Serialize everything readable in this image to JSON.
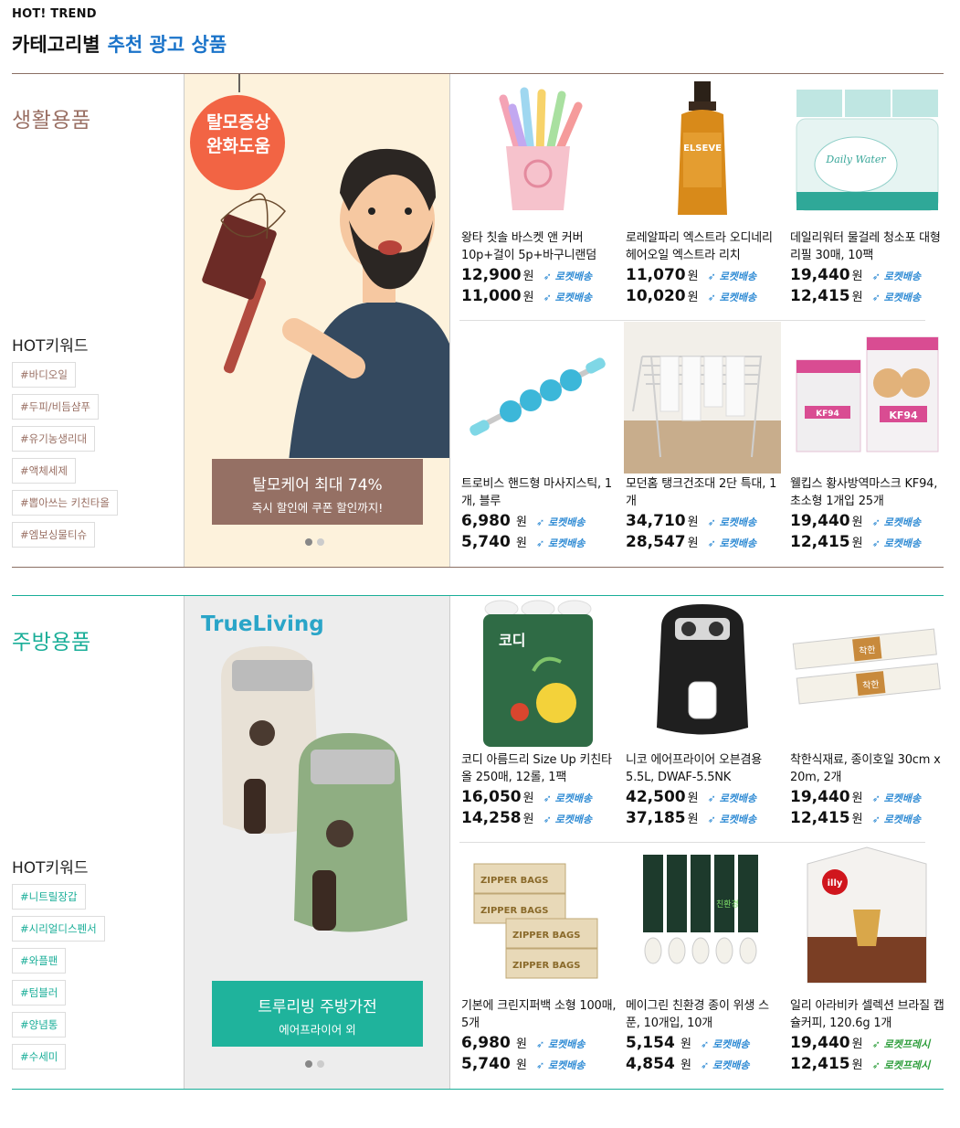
{
  "header": {
    "eyebrow": "HOT! TREND",
    "title": "카테고리별",
    "title_accent": "추천 광고 상품"
  },
  "sections": [
    {
      "category": "생활용품",
      "accent_color": "#9a7064",
      "line_color": "#8a6f63",
      "kw_title": "HOT키워드",
      "keywords": [
        "#바디오일",
        "#두피/비듬샴푸",
        "#유기농생리대",
        "#액체세제",
        "#뽑아쓰는 키친타올",
        "#엠보싱물티슈"
      ],
      "banner": {
        "badge": "탈모증상\n완화도움",
        "caption_main": "탈모케어 최대 74%",
        "caption_sub": "즉시 할인에 쿠폰 할인까지!",
        "caption_color": "#957064",
        "bg_color": "#fdf2dc"
      },
      "products": [
        {
          "name": "왕타 칫솔 바스켓 앤 커버 10p+걸이 5p+바구니랜덤",
          "price1": "12,900",
          "price2": "11,000",
          "won": "원",
          "tag1": "로켓배송",
          "tag2": "로켓배송",
          "icon": "toothbrush-cup"
        },
        {
          "name": "로레알파리 엑스트라 오디네리 헤어오일 엑스트라 리치",
          "price1": "11,070",
          "price2": "10,020",
          "won": "원",
          "tag1": "로켓배송",
          "tag2": "로켓배송",
          "icon": "hair-oil-bottle",
          "img_text": "ELSEVE"
        },
        {
          "name": "데일리워터 물걸레 청소포 대형리필 30매, 10팩",
          "price1": "19,440",
          "price2": "12,415",
          "won": "원",
          "tag1": "로켓배송",
          "tag2": "로켓배송",
          "icon": "wet-wipes-pack",
          "img_text": "Daily Water"
        },
        {
          "name": "트로비스 핸드형 마사지스틱, 1개, 블루",
          "price1": "6,980",
          "price2": "5,740",
          "won": "원",
          "tag1": "로켓배송",
          "tag2": "로켓배송",
          "icon": "massage-stick"
        },
        {
          "name": "모던홈 탱크건조대 2단 특대, 1개",
          "price1": "34,710",
          "price2": "28,547",
          "won": "원",
          "tag1": "로켓배송",
          "tag2": "로켓배송",
          "icon": "drying-rack"
        },
        {
          "name": "웰킵스 황사방역마스크 KF94, 초소형 1개입 25개",
          "price1": "19,440",
          "price2": "12,415",
          "won": "원",
          "tag1": "로켓배송",
          "tag2": "로켓배송",
          "icon": "mask-box",
          "img_text": "KF94"
        }
      ]
    },
    {
      "category": "주방용품",
      "accent_color": "#1aae98",
      "line_color": "#1aae98",
      "kw_title": "HOT키워드",
      "keywords": [
        "#니트릴장갑",
        "#시리얼디스펜서",
        "#와플팬",
        "#텀블러",
        "#양념통",
        "#수세미"
      ],
      "banner": {
        "brand": "TrueLiving",
        "caption_main": "트루리빙 주방가전",
        "caption_sub": "에어프라이어 외",
        "caption_color": "#1fb39c",
        "bg_color": "#ededed"
      },
      "products": [
        {
          "name": " 코디 아름드리 Size Up 키친타올 250매, 12롤, 1팩",
          "price1": "16,050",
          "price2": "14,258",
          "won": "원",
          "tag1": "로켓배송",
          "tag2": "로켓배송",
          "icon": "kitchen-towel-pack",
          "img_text": "코디"
        },
        {
          "name": "니코 에어프라이어 오븐겸용 5.5L, DWAF-5.5NK",
          "price1": "42,500",
          "price2": "37,185",
          "won": "원",
          "tag1": "로켓배송",
          "tag2": "로켓배송",
          "icon": "air-fryer"
        },
        {
          "name": "착한식재료, 종이호일 30cm x 20m, 2개",
          "price1": "19,440",
          "price2": "12,415",
          "won": "원",
          "tag1": "로켓배송",
          "tag2": "로켓배송",
          "icon": "foil-roll-box",
          "img_text": "착한"
        },
        {
          "name": "기본에 크린지퍼백 소형 100매, 5개",
          "price1": "6,980",
          "price2": "5,740",
          "won": "원",
          "tag1": "로켓배송",
          "tag2": "로켓배송",
          "icon": "zipper-bags",
          "img_text": "ZIPPER BAGS"
        },
        {
          "name": "메이그린 친환경 종이 위생 스푼, 10개입, 10개",
          "price1": "5,154",
          "price2": "4,854",
          "won": "원",
          "tag1": "로켓배송",
          "tag2": "로켓배송",
          "icon": "paper-spoons",
          "img_text": "친환경"
        },
        {
          "name": "일리 아라비카 셀렉션 브라질 캡슐커피, 120.6g 1개",
          "price1": "19,440",
          "price2": "12,415",
          "won": "원",
          "tag1": "로켓프레시",
          "tag2": "로켓프레시",
          "icon": "coffee-capsule-box",
          "img_text": "illy",
          "fresh": true
        }
      ]
    }
  ]
}
